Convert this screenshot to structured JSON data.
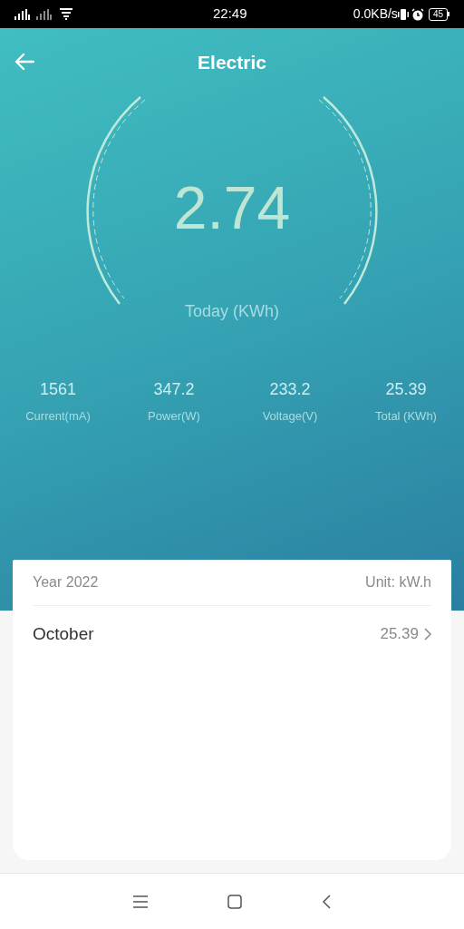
{
  "status_bar": {
    "time": "22:49",
    "network_speed": "0.0KB/s",
    "battery": "45"
  },
  "header": {
    "title": "Electric"
  },
  "gauge": {
    "value": "2.74",
    "label": "Today (KWh)"
  },
  "stats": [
    {
      "value": "1561",
      "label": "Current(mA)"
    },
    {
      "value": "347.2",
      "label": "Power(W)"
    },
    {
      "value": "233.2",
      "label": "Voltage(V)"
    },
    {
      "value": "25.39",
      "label": "Total (KWh)"
    }
  ],
  "card": {
    "year": "Year 2022",
    "unit": "Unit: kW.h",
    "rows": [
      {
        "month": "October",
        "value": "25.39"
      }
    ]
  }
}
